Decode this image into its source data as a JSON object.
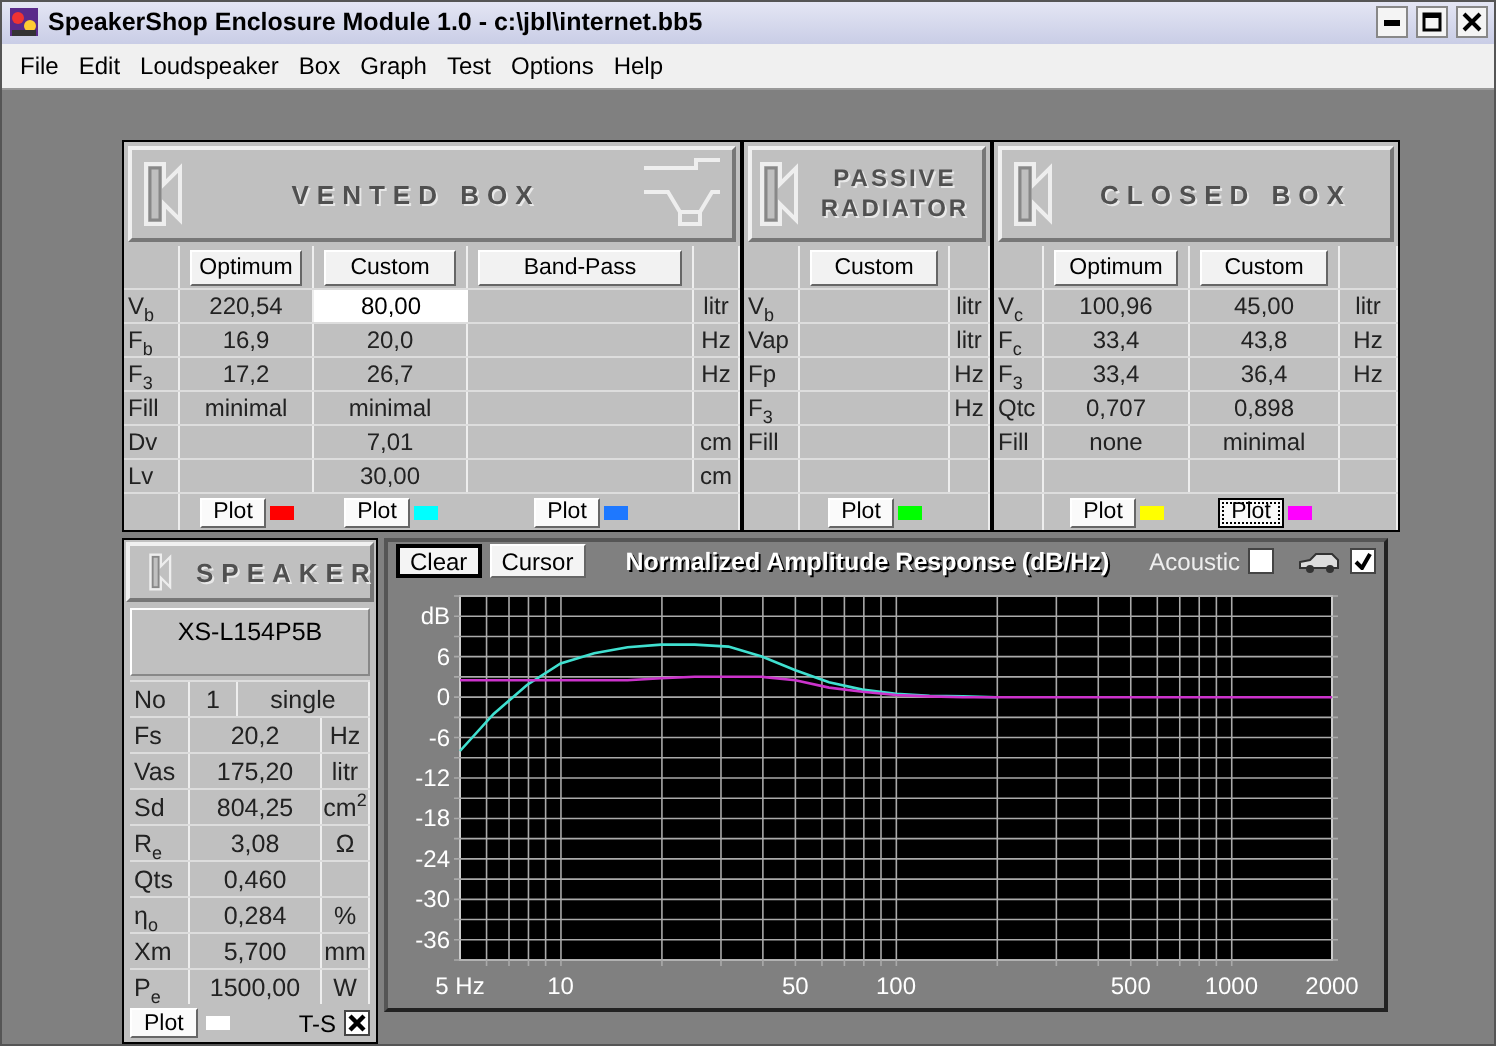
{
  "window": {
    "title": "SpeakerShop Enclosure Module 1.0 - c:\\jbl\\internet.bb5"
  },
  "menu": [
    "File",
    "Edit",
    "Loudspeaker",
    "Box",
    "Graph",
    "Test",
    "Options",
    "Help"
  ],
  "sections": [
    {
      "kind": "vented",
      "title": "VENTED BOX",
      "rows": [
        {
          "label": "V$_{b}$",
          "unit": "litr"
        },
        {
          "label": "F$_{b}$",
          "unit": "Hz"
        },
        {
          "label": "F$_{3}$",
          "unit": "Hz"
        },
        {
          "label": "Fill"
        },
        {
          "label": "Dv",
          "unit": "cm"
        },
        {
          "label": "Lv",
          "unit": "cm"
        }
      ],
      "columns": [
        {
          "header": "Optimum",
          "values": [
            "220,54",
            "16,9",
            "17,2",
            "minimal"
          ],
          "plot": {
            "label": "Plot",
            "color": "#ff0000",
            "focused": false
          }
        },
        {
          "header": "Custom",
          "values": [
            {
              "kind": "field",
              "value": "80,00"
            },
            "20,0",
            "26,7",
            "minimal",
            "7,01",
            "30,00"
          ],
          "plot": {
            "label": "Plot",
            "color": "#00ffff",
            "focused": false
          }
        },
        {
          "header": "Band-Pass",
          "plot": {
            "label": "Plot",
            "color": "#1e78ff",
            "focused": false
          }
        }
      ]
    },
    {
      "kind": "passive",
      "title": "PASSIVE RADIATOR",
      "rows": [
        {
          "label": "V$_{b}$",
          "unit": "litr"
        },
        {
          "label": "Vap",
          "unit": "litr"
        },
        {
          "label": "Fp",
          "unit": "Hz"
        },
        {
          "label": "F$_{3}$",
          "unit": "Hz"
        },
        {
          "label": "Fill"
        },
        {}
      ],
      "columns": [
        {
          "header": "Custom",
          "plot": {
            "label": "Plot",
            "color": "#00ff00",
            "focused": false
          }
        }
      ]
    },
    {
      "kind": "closed",
      "title": "CLOSED BOX",
      "rows": [
        {
          "label": "V$_{c}$",
          "unit": "litr"
        },
        {
          "label": "F$_{c}$",
          "unit": "Hz"
        },
        {
          "label": "F$_{3}$",
          "unit": "Hz"
        },
        {
          "label": "Qtc"
        },
        {
          "label": "Fill"
        },
        {}
      ],
      "columns": [
        {
          "header": "Optimum",
          "values": [
            "100,96",
            "33,4",
            "33,4",
            "0,707",
            "none"
          ],
          "plot": {
            "label": "Plot",
            "color": "#ffff00",
            "focused": false
          }
        },
        {
          "header": "Custom",
          "values": [
            "45,00",
            "43,8",
            "36,4",
            "0,898",
            "minimal"
          ],
          "plot": {
            "label": "Plot",
            "color": "#ff00ff",
            "focused": true
          }
        }
      ]
    }
  ],
  "speaker": {
    "title": "SPEAKER",
    "model": "XS-L154P5B",
    "rows": [
      {
        "kind": "count",
        "label": "No",
        "value": "1",
        "unit": "single"
      },
      {
        "kind": "param",
        "label": "Fs",
        "value": "20,2",
        "unit": "Hz"
      },
      {
        "kind": "param",
        "label": "Vas",
        "value": "175,20",
        "unit": "litr"
      },
      {
        "kind": "param",
        "label": "Sd",
        "value": "804,25",
        "unit": "cm$^{2}$"
      },
      {
        "kind": "param",
        "label": "R$_{e}$",
        "value": "3,08",
        "unit": "Ω"
      },
      {
        "kind": "param",
        "label": "Qts",
        "value": "0,460"
      },
      {
        "kind": "param",
        "label": "η$_{o}$",
        "value": "0,284",
        "unit": "%"
      },
      {
        "kind": "param",
        "label": "Xm",
        "value": "5,700",
        "unit": "mm"
      },
      {
        "kind": "param",
        "label": "P$_{e}$",
        "value": "1500,00",
        "unit": "W"
      }
    ],
    "plot": {
      "label": "Plot",
      "color": "#ffffff"
    },
    "ts": {
      "label": "T-S",
      "checked": true
    }
  },
  "graph": {
    "buttons": [
      {
        "label": "Clear",
        "focused": true
      },
      {
        "label": "Cursor",
        "focused": false
      }
    ],
    "title": "Normalized Amplitude Response (dB/Hz)",
    "acoustic": {
      "label": "Acoustic",
      "checked": false
    },
    "car": {
      "checked": true
    },
    "chart_data": {
      "type": "line",
      "grid": true,
      "ylim": [
        -39,
        15
      ],
      "categories": [
        "5 Hz",
        null,
        null,
        "10",
        null,
        null,
        null,
        null,
        null,
        null,
        "50",
        null,
        null,
        "100",
        null,
        null,
        null,
        null,
        null,
        null,
        "500",
        null,
        null,
        "1000",
        null,
        null,
        "2000"
      ],
      "series": [
        {
          "color": "#40e0d0",
          "values": [
            -8,
            -2.5,
            1.8,
            5,
            6.5,
            7.4,
            7.8,
            7.8,
            7.5,
            6,
            4,
            2.2,
            1.1,
            0.5,
            0.2,
            0.1,
            0,
            null,
            null,
            null,
            null,
            null,
            null,
            null,
            null,
            null,
            null
          ]
        },
        {
          "color": "#cc33cc",
          "values": [
            2.5,
            2.5,
            2.5,
            2.5,
            2.5,
            2.5,
            2.8,
            3,
            3,
            3,
            2.5,
            1.4,
            0.8,
            0.3,
            0.1,
            0,
            0,
            0,
            0,
            0,
            0,
            0,
            0,
            0,
            0,
            0,
            0
          ]
        }
      ],
      "yticks": [
        {
          "value": 12,
          "label": "dB"
        },
        6,
        0,
        -6,
        -12,
        -18,
        -24,
        -30,
        -36
      ]
    }
  }
}
